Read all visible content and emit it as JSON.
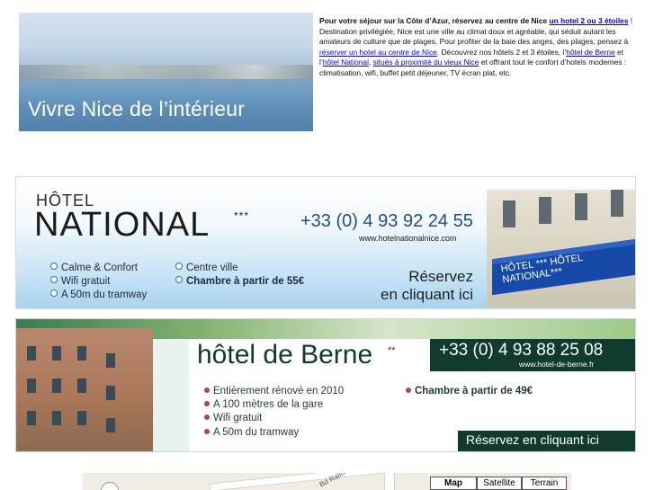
{
  "hero": {
    "caption": "Vivre Nice de l’intérieur"
  },
  "intro": {
    "p1_bold": "Pour votre séjour sur la Côte d’Azur, réservez au centre de Nice",
    "p1_link": "un hotel 2 ou 3 étoiles",
    "p1_end": " !",
    "p2a": "Destination privilégiée, Nice est une ville au climat doux et agréable, qui séduit autant les amateurs de culture que de plages. Pour profiter de la baie des anges, des plages, pensez à ",
    "p2_link1": "réserver un hotel au centre de Nice",
    "p2b": ". Découvrez nos hôtels 2 et 3 étoiles, l’",
    "p2_link2": "hôtel de Berne",
    "p2c": " et l’",
    "p2_link3": "hôtel National",
    "p2d": ", ",
    "p2_link4": "situés à proximité du vieux Nice",
    "p2e": " et offrant tout le confort d’hotels modernes : climatisation, wifi, buffet petit déjeuner, TV écran plat, etc."
  },
  "national": {
    "hotel": "HÔTEL",
    "name": "NATIONAL",
    "stars": "***",
    "phone": "+33 (0) 4 93 92 24 55",
    "url": "www.hotelnationalnice.com",
    "features_left": [
      "Calme & Confort",
      "Wifi gratuit",
      "A 50m  du tramway"
    ],
    "features_right": [
      "Centre ville",
      "Chambre à partir de 55€"
    ],
    "reserve_line1": "Réservez",
    "reserve_line2": "en cliquant ici",
    "awning": "HÔTEL  ***   HÔTEL NATIONAL***"
  },
  "berne": {
    "title": "hôtel de Berne",
    "stars": "**",
    "phone": "+33 (0) 4 93 88 25 08",
    "url": "www.hotel-de-berne.fr",
    "features": [
      "Entièrement rénové en 2010",
      "A 100 mètres de la gare",
      "Wifi gratuit",
      "A 50m  du tramway"
    ],
    "price": "Chambre à partir de 49€",
    "reserve": "Réservez en cliquant ici"
  },
  "map": {
    "street": "Bd Raim",
    "buttons": [
      "Map",
      "Satellite",
      "Terrain"
    ],
    "selected": "Map"
  },
  "colors": {
    "national_blue": "#1b4f8a",
    "berne_green": "#113b2e",
    "link": "#0000ee"
  }
}
